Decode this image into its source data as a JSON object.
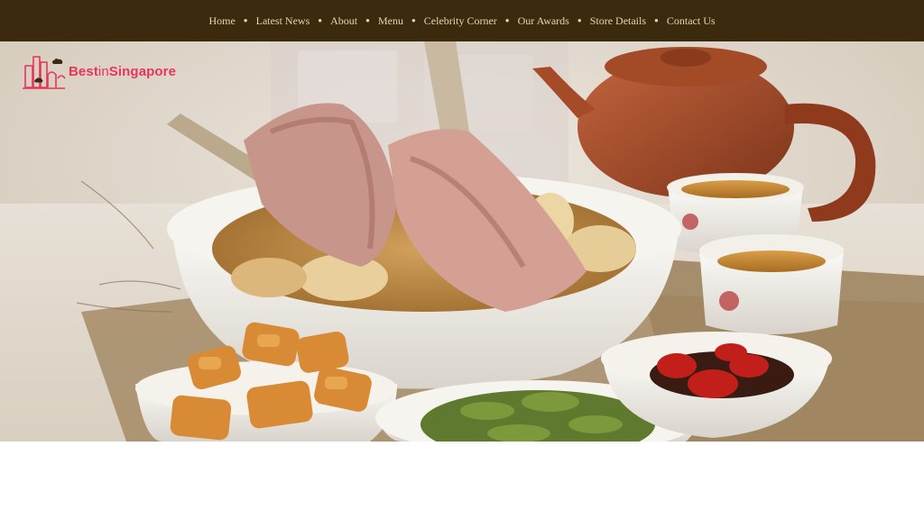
{
  "nav": {
    "items": [
      {
        "label": "Home"
      },
      {
        "label": "Latest News"
      },
      {
        "label": "About"
      },
      {
        "label": "Menu"
      },
      {
        "label": "Celebrity Corner"
      },
      {
        "label": "Our Awards"
      },
      {
        "label": "Store Details"
      },
      {
        "label": "Contact Us"
      }
    ],
    "separator": "●"
  },
  "logo": {
    "text_best": "Best",
    "text_in": "in",
    "text_singapore": "Singapore",
    "icon": "city-skyline-logo-icon"
  },
  "hero": {
    "image": "bak-kut-teh-food-photo",
    "colors": {
      "nav_bg": "#3b2a0d",
      "nav_text": "#e8d6ab",
      "logo": "#e8345c"
    }
  }
}
